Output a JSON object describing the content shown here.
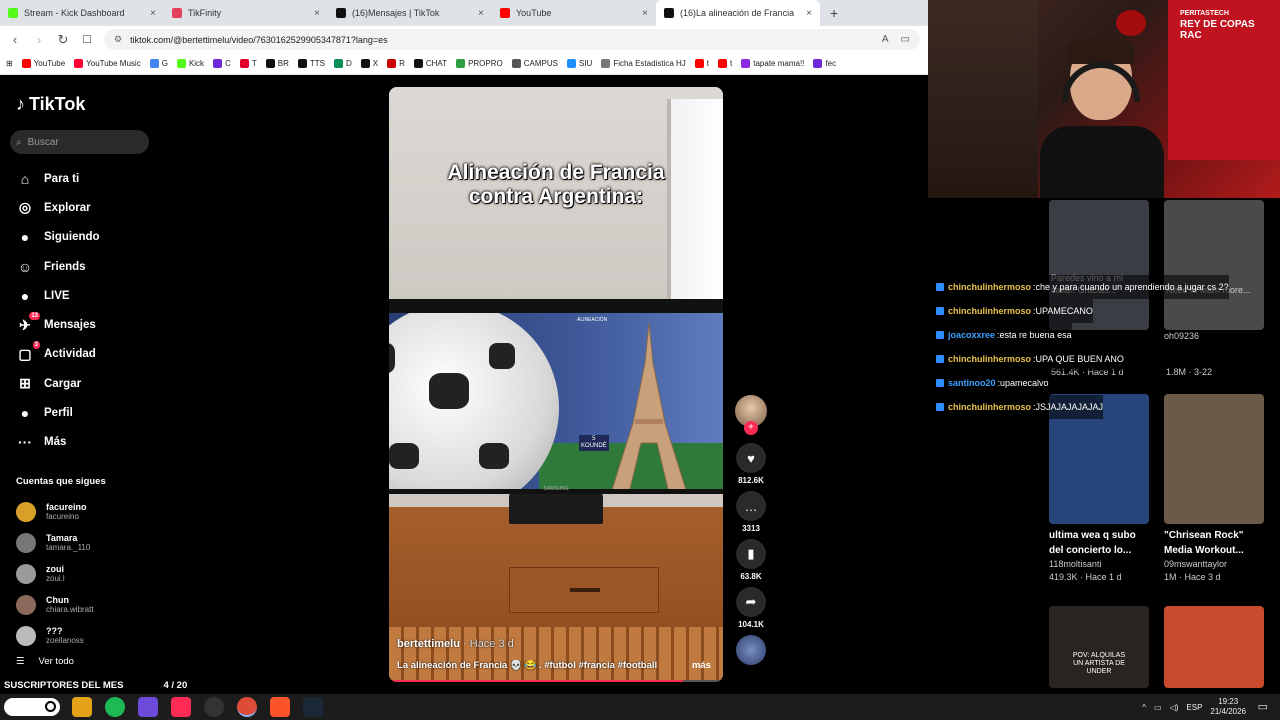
{
  "browser": {
    "tabs": [
      {
        "label": "Stream - Kick Dashboard",
        "color": "#53fc18"
      },
      {
        "label": "TikFinity",
        "color": "#e6405f"
      },
      {
        "label": "(16)Mensajes | TikTok",
        "color": "#111111"
      },
      {
        "label": "YouTube",
        "color": "#ff0000"
      },
      {
        "label": "(16)La alineación de Francia",
        "color": "#111111",
        "active": true
      }
    ],
    "new_tab": "+",
    "url": "tiktok.com/@bertettimelu/video/7630162529905347871?lang=es",
    "bookmarks": [
      "YouTube",
      "YouTube Music",
      "G",
      "Kick",
      "C",
      "T",
      "BR",
      "TTS",
      "D",
      "X",
      "R",
      "CHAT",
      "PROPRO",
      "CAMPUS",
      "SIU",
      "Ficha Estadistica HJ",
      "t",
      "t",
      "tapate mama!!",
      "fec"
    ]
  },
  "sidebar": {
    "logo": "TikTok",
    "search_placeholder": "Buscar",
    "nav": [
      {
        "label": "Para ti",
        "icon": "home-icon",
        "glyph": "⌂"
      },
      {
        "label": "Explorar",
        "icon": "compass-icon",
        "glyph": "◎"
      },
      {
        "label": "Siguiendo",
        "icon": "following-icon",
        "glyph": "●"
      },
      {
        "label": "Friends",
        "icon": "friends-icon",
        "glyph": "☺"
      },
      {
        "label": "LIVE",
        "icon": "live-icon",
        "glyph": "●"
      },
      {
        "label": "Mensajes",
        "icon": "messages-icon",
        "glyph": "✈",
        "badge": "13"
      },
      {
        "label": "Actividad",
        "icon": "activity-icon",
        "glyph": "▢",
        "badge": "3"
      },
      {
        "label": "Cargar",
        "icon": "upload-icon",
        "glyph": "⊞"
      },
      {
        "label": "Perfil",
        "icon": "profile-icon",
        "glyph": "●"
      },
      {
        "label": "Más",
        "icon": "more-icon",
        "glyph": "···"
      }
    ],
    "following_title": "Cuentas que sigues",
    "following": [
      {
        "name": "facureino",
        "handle": "facureino",
        "color": "#d8a028"
      },
      {
        "name": "Tamara",
        "handle": "tamara._110",
        "color": "#777777"
      },
      {
        "name": "zoui",
        "handle": "zoui.l",
        "color": "#9a9a9a"
      },
      {
        "name": "Chun",
        "handle": "chiara.wibratt",
        "color": "#8a6a5a"
      },
      {
        "name": "???",
        "handle": "zoellanoss",
        "color": "#bbbbbb"
      }
    ],
    "see_all": "Ver todo"
  },
  "video": {
    "overlay_line1": "Alineación de Francia",
    "overlay_line2": "contra Argentina:",
    "tv_label": "ALINEACIÓN",
    "player_number": "5",
    "player_name": "KOUNDÉ",
    "tv_brand": "SAMSUNG",
    "author": "bertettimelu",
    "time_ago": " · Hace 3 d",
    "caption": "La alineación de Francia 💀 😂 . #futbol #francia #football ...",
    "more": "más",
    "progress": 0.88
  },
  "actions": {
    "likes": "812.6K",
    "comments": "3313",
    "saves": "63.8K",
    "shares": "104.1K"
  },
  "webcam": {
    "brand": "PERITASTECH",
    "flag_text": "REY DE COPAS",
    "flag_text2": "RAC"
  },
  "grid": [
    {
      "title": "",
      "author": "",
      "stats": "561.4K · Hace 1 d",
      "overlay": "Paredes vino a mi casa!! Gracias...",
      "thumb_color": "#3b3d44"
    },
    {
      "title": "",
      "author": "oh09236",
      "stats": "1.8M · 3-22",
      "overlay": "Need to learn more...",
      "thumb_color": "#4a4a4a"
    },
    {
      "title": "ultima wea q subo del concierto lo...",
      "author": "118moltisanti",
      "stats": "419.3K · Hace 1 d",
      "thumb_color": "#27457a"
    },
    {
      "title": "\"Chrisean Rock\" Media Workout...",
      "author": "09mswanttaylor",
      "stats": "1M · Hace 3 d",
      "thumb_color": "#6a5a48"
    },
    {
      "title": "",
      "author": "",
      "stats": "",
      "overlay": "POV: ALQUILAS UN ARTISTA DE UNDER",
      "thumb_color": "#2a2420"
    },
    {
      "title": "",
      "author": "",
      "stats": "",
      "thumb_color": "#c94b2e"
    }
  ],
  "chat": [
    {
      "user": "chinchulinhermoso",
      "text": "che y para cuando un aprendiendo a jugar cs 2?",
      "color": "#e7c14a"
    },
    {
      "user": "chinchulinhermoso",
      "text": "UPAMECANO",
      "color": "#e7c14a"
    },
    {
      "user": "joacoxxree",
      "text": "esta re buena esa",
      "color": "#3aa0ff"
    },
    {
      "user": "chinchulinhermoso",
      "text": "UPA QUE BUEN ANO",
      "color": "#e7c14a"
    },
    {
      "user": "santinoo20",
      "text": "upamecalvo",
      "color": "#3aa0ff"
    },
    {
      "user": "chinchulinhermoso",
      "text": "JSJAJAJAJAJAJ",
      "color": "#e7c14a"
    }
  ],
  "subs": {
    "label": "SUSCRIPTORES DEL MES",
    "count": "4 / 20"
  },
  "taskbar": {
    "lang": "ESP",
    "time": "19:23",
    "date": "21/4/2026"
  }
}
